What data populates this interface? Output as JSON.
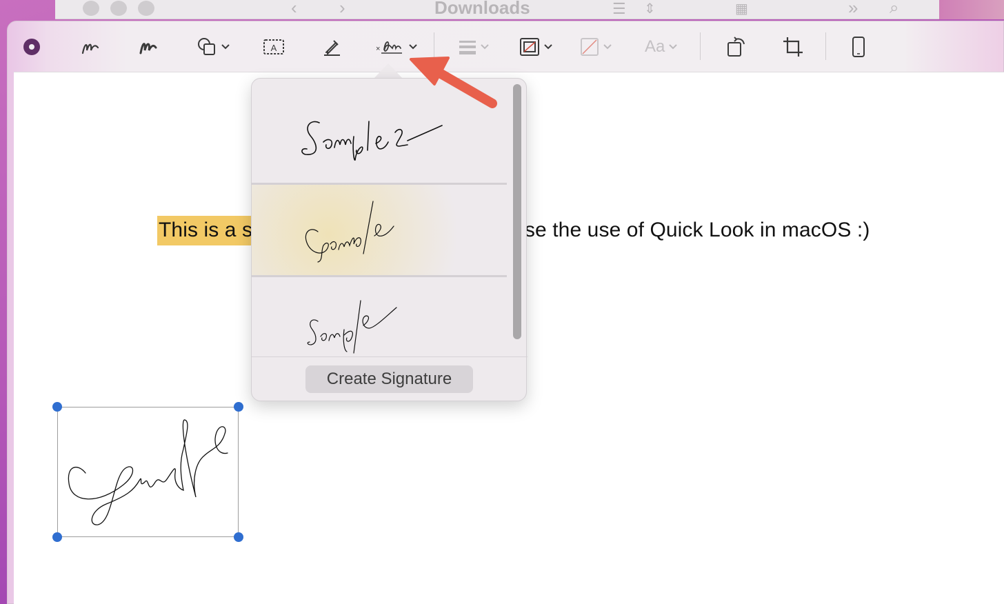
{
  "finder": {
    "title": "Downloads"
  },
  "toolbar": {
    "font_label": "Aa",
    "items": [
      "markup-tool",
      "sketch",
      "draw",
      "shapes",
      "text",
      "highlight",
      "sign",
      "shape-style",
      "border-color",
      "fill-color",
      "text-style",
      "rotate",
      "crop",
      "device"
    ]
  },
  "document": {
    "text_highlighted": "This is a s",
    "text_rest": "ase the use of Quick Look in macOS :)"
  },
  "signature_popover": {
    "options": [
      "Sample 2",
      "Sample",
      "Sample"
    ],
    "create_button_label": "Create Signature"
  },
  "colors": {
    "highlight": "#f2c965",
    "selection_handle": "#2f6ed0",
    "annotation_arrow": "#e8604c"
  }
}
